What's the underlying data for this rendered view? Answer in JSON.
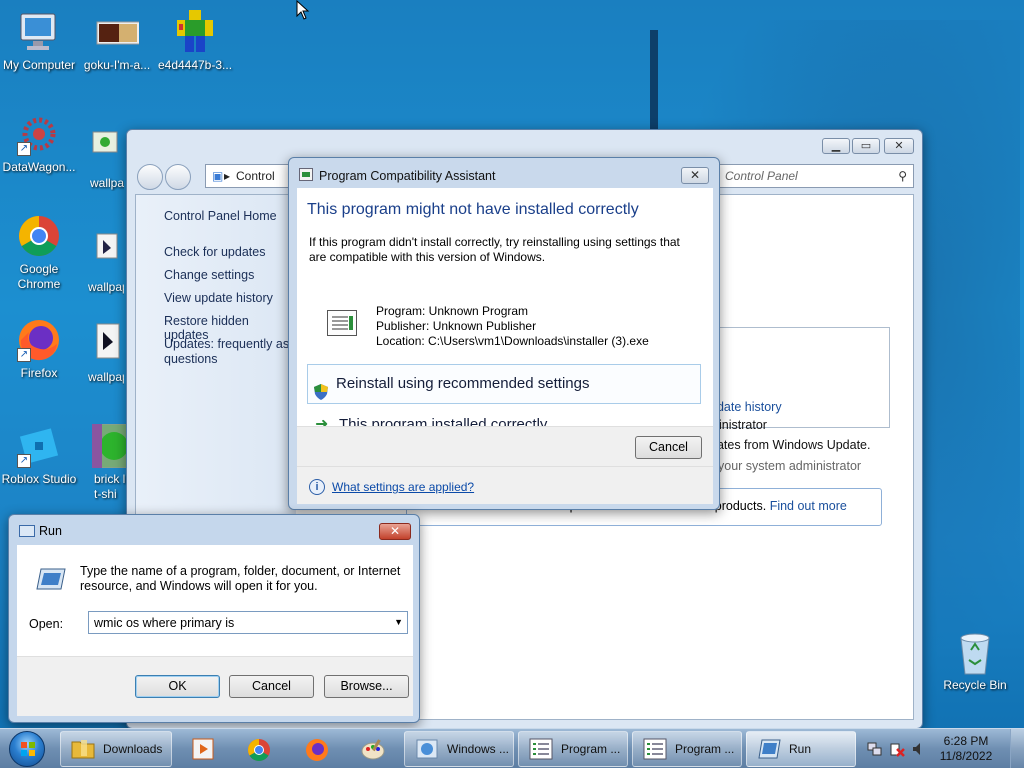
{
  "desktop": {
    "icons": [
      {
        "label": "My Computer",
        "icon": "computer-icon"
      },
      {
        "label": "goku-I'm-a...",
        "icon": "image-icon"
      },
      {
        "label": "e4d4447b-3...",
        "icon": "roblox-character-icon"
      },
      {
        "label": "DataWagon...",
        "icon": "datawagon-icon"
      },
      {
        "label": "wallpa",
        "icon": "wallpaper-icon"
      },
      {
        "label": "Google Chrome",
        "icon": "chrome-icon"
      },
      {
        "label": "wallpap",
        "icon": "wallpaper-icon"
      },
      {
        "label": "Firefox",
        "icon": "firefox-icon"
      },
      {
        "label": "wallpap",
        "icon": "wallpaper-icon"
      },
      {
        "label": "Roblox Studio",
        "icon": "roblox-studio-icon"
      },
      {
        "label": "brick l t-shi",
        "icon": "tshirt-icon"
      },
      {
        "label": "Recycle Bin",
        "icon": "recycle-bin-icon"
      }
    ]
  },
  "control_panel": {
    "address": "Control",
    "search_placeholder": "Control Panel",
    "left_nav": {
      "home": "Control Panel Home",
      "items": [
        "Check for updates",
        "Change settings",
        "View update history",
        "Restore hidden updates",
        "Updates: frequently aske",
        "questions"
      ]
    },
    "right": {
      "link_update_history": "pdate history",
      "administrator": "inistrator",
      "windows_update": "dates from Windows Update.",
      "system_admin": "your system administrator",
      "other_products": "Get updates for other Microsoft products.",
      "find_out_more": "Find out more"
    }
  },
  "pca": {
    "title": "Program Compatibility Assistant",
    "heading": "This program might not have installed correctly",
    "description": "If this program didn't install correctly, try reinstalling using settings that are compatible with this version of Windows.",
    "program": "Program: Unknown Program",
    "publisher": "Publisher: Unknown Publisher",
    "location": "Location: C:\\Users\\vm1\\Downloads\\installer (3).exe",
    "option_reinstall": "Reinstall using recommended settings",
    "option_correct": "This program installed correctly",
    "cancel": "Cancel",
    "settings_link": "What settings are applied?"
  },
  "run": {
    "title": "Run",
    "description": "Type the name of a program, folder, document, or Internet resource, and Windows will open it for you.",
    "open_label": "Open:",
    "input_value": "wmic os where primary is",
    "ok": "OK",
    "cancel": "Cancel",
    "browse": "Browse..."
  },
  "taskbar": {
    "items": [
      {
        "label": "Downloads",
        "icon": "folder-icon"
      },
      {
        "label": "Windows ...",
        "icon": "windows-update-icon"
      },
      {
        "label": "Program ...",
        "icon": "program-window-icon"
      },
      {
        "label": "Program ...",
        "icon": "program-window-icon"
      },
      {
        "label": "Run",
        "icon": "run-icon"
      }
    ],
    "time": "6:28 PM",
    "date": "11/8/2022"
  },
  "colors": {
    "desktop": "#1c8fd0",
    "link": "#0b4aa8",
    "pca_heading": "#1a3f8a"
  }
}
